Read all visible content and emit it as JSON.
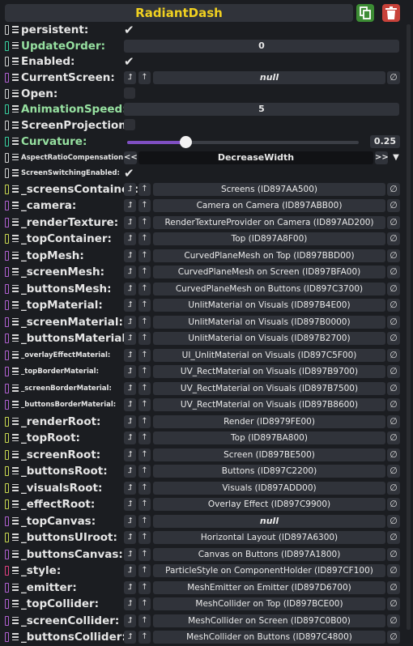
{
  "header": {
    "title": "RadiantDash"
  },
  "rows": [
    {
      "label": "persistent",
      "kind": "bool",
      "checked": true,
      "conn": "#d0d0d0"
    },
    {
      "label": "UpdateOrder",
      "kind": "field",
      "value": "0",
      "green": true,
      "conn": "#38d0a0"
    },
    {
      "label": "Enabled",
      "kind": "bool",
      "checked": true,
      "conn": "#d0d0d0"
    },
    {
      "label": "CurrentScreen",
      "kind": "ref",
      "value": "null",
      "conn": "#b060d0"
    },
    {
      "label": "Open",
      "kind": "bool",
      "checked": false,
      "conn": "#d0d0d0"
    },
    {
      "label": "AnimationSpeed",
      "kind": "field",
      "value": "5",
      "green": true,
      "conn": "#38d0a0"
    },
    {
      "label": "ScreenProjection",
      "kind": "bool",
      "checked": false,
      "conn": "#d0d0d0"
    },
    {
      "label": "Curvature",
      "kind": "slider",
      "value": "0.25",
      "fraction": 0.25,
      "green": true,
      "conn": "#38d0a0"
    },
    {
      "label": "AspectRatioCompensation",
      "kind": "enum",
      "value": "DecreaseWidth",
      "size": "small",
      "conn": "#d0d0d0"
    },
    {
      "label": "ScreenSwitchingEnabled",
      "kind": "bool",
      "checked": true,
      "size": "small",
      "conn": "#d0d0d0"
    },
    {
      "label": "_screensContainer",
      "kind": "ref",
      "value": "Screens (ID897AA500)",
      "conn": "#c8d850"
    },
    {
      "label": "_camera",
      "kind": "ref",
      "value": "Camera on Camera (ID897ABB00)",
      "conn": "#b060d0"
    },
    {
      "label": "_renderTexture",
      "kind": "ref",
      "value": "RenderTextureProvider on Camera (ID897AD200)",
      "conn": "#b060d0"
    },
    {
      "label": "_topContainer",
      "kind": "ref",
      "value": "Top (ID897A8F00)",
      "conn": "#c8d850"
    },
    {
      "label": "_topMesh",
      "kind": "ref",
      "value": "CurvedPlaneMesh on Top (ID897BBD00)",
      "conn": "#b060d0"
    },
    {
      "label": "_screenMesh",
      "kind": "ref",
      "value": "CurvedPlaneMesh on Screen (ID897BFA00)",
      "conn": "#b060d0"
    },
    {
      "label": "_buttonsMesh",
      "kind": "ref",
      "value": "CurvedPlaneMesh on Buttons (ID897C3700)",
      "conn": "#b060d0"
    },
    {
      "label": "_topMaterial",
      "kind": "ref",
      "value": "UnlitMaterial on Visuals (ID897B4E00)",
      "conn": "#b060d0"
    },
    {
      "label": "_screenMaterial",
      "kind": "ref",
      "value": "UnlitMaterial on Visuals (ID897B0000)",
      "conn": "#b060d0"
    },
    {
      "label": "_buttonsMaterial",
      "kind": "ref",
      "value": "UnlitMaterial on Visuals (ID897B2700)",
      "conn": "#b060d0"
    },
    {
      "label": "_overlayEffectMaterial",
      "kind": "ref",
      "value": "UI_UnlitMaterial on Visuals (ID897C5F00)",
      "size": "small",
      "conn": "#b060d0"
    },
    {
      "label": "_topBorderMaterial",
      "kind": "ref",
      "value": "UV_RectMaterial on Visuals (ID897B9700)",
      "size": "small",
      "conn": "#b060d0"
    },
    {
      "label": "_screenBorderMaterial",
      "kind": "ref",
      "value": "UV_RectMaterial on Visuals (ID897B7500)",
      "size": "small",
      "conn": "#b060d0"
    },
    {
      "label": "_buttonsBorderMaterial",
      "kind": "ref",
      "value": "UV_RectMaterial on Visuals (ID897B8600)",
      "size": "small",
      "conn": "#b060d0"
    },
    {
      "label": "_renderRoot",
      "kind": "ref",
      "value": "Render (ID8979FE00)",
      "conn": "#c8d850"
    },
    {
      "label": "_topRoot",
      "kind": "ref",
      "value": "Top (ID897BA800)",
      "conn": "#c8d850"
    },
    {
      "label": "_screenRoot",
      "kind": "ref",
      "value": "Screen (ID897BE500)",
      "conn": "#c8d850"
    },
    {
      "label": "_buttonsRoot",
      "kind": "ref",
      "value": "Buttons (ID897C2200)",
      "conn": "#c8d850"
    },
    {
      "label": "_visualsRoot",
      "kind": "ref",
      "value": "Visuals (ID897ADD00)",
      "conn": "#c8d850"
    },
    {
      "label": "_effectRoot",
      "kind": "ref",
      "value": "Overlay Effect (ID897C9900)",
      "conn": "#c8d850"
    },
    {
      "label": "_topCanvas",
      "kind": "ref",
      "value": "null",
      "conn": "#b060d0"
    },
    {
      "label": "_buttonsUIroot",
      "kind": "ref",
      "value": "Horizontal Layout (ID897A6300)",
      "conn": "#c8d850"
    },
    {
      "label": "_buttonsCanvas",
      "kind": "ref",
      "value": "Canvas on Buttons (ID897A1800)",
      "conn": "#b060d0"
    },
    {
      "label": "_style",
      "kind": "ref",
      "value": "ParticleStyle on ComponentHolder (ID897CF100)",
      "conn": "#e04080"
    },
    {
      "label": "_emitter",
      "kind": "ref",
      "value": "MeshEmitter on Emitter (ID897D6700)",
      "conn": "#b060d0"
    },
    {
      "label": "_topCollider",
      "kind": "ref",
      "value": "MeshCollider on Top (ID897BCE00)",
      "conn": "#b060d0"
    },
    {
      "label": "_screenCollider",
      "kind": "ref",
      "value": "MeshCollider on Screen (ID897C0B00)",
      "conn": "#b060d0"
    },
    {
      "label": "_buttonsCollider",
      "kind": "ref",
      "value": "MeshCollider on Buttons (ID897C4800)",
      "conn": "#b060d0"
    }
  ],
  "icons": {
    "check": "✔",
    "set": "⮥",
    "jump": "↑",
    "null_btn": "∅",
    "prev": "<<",
    "next": ">>",
    "dropdown": "▼"
  }
}
